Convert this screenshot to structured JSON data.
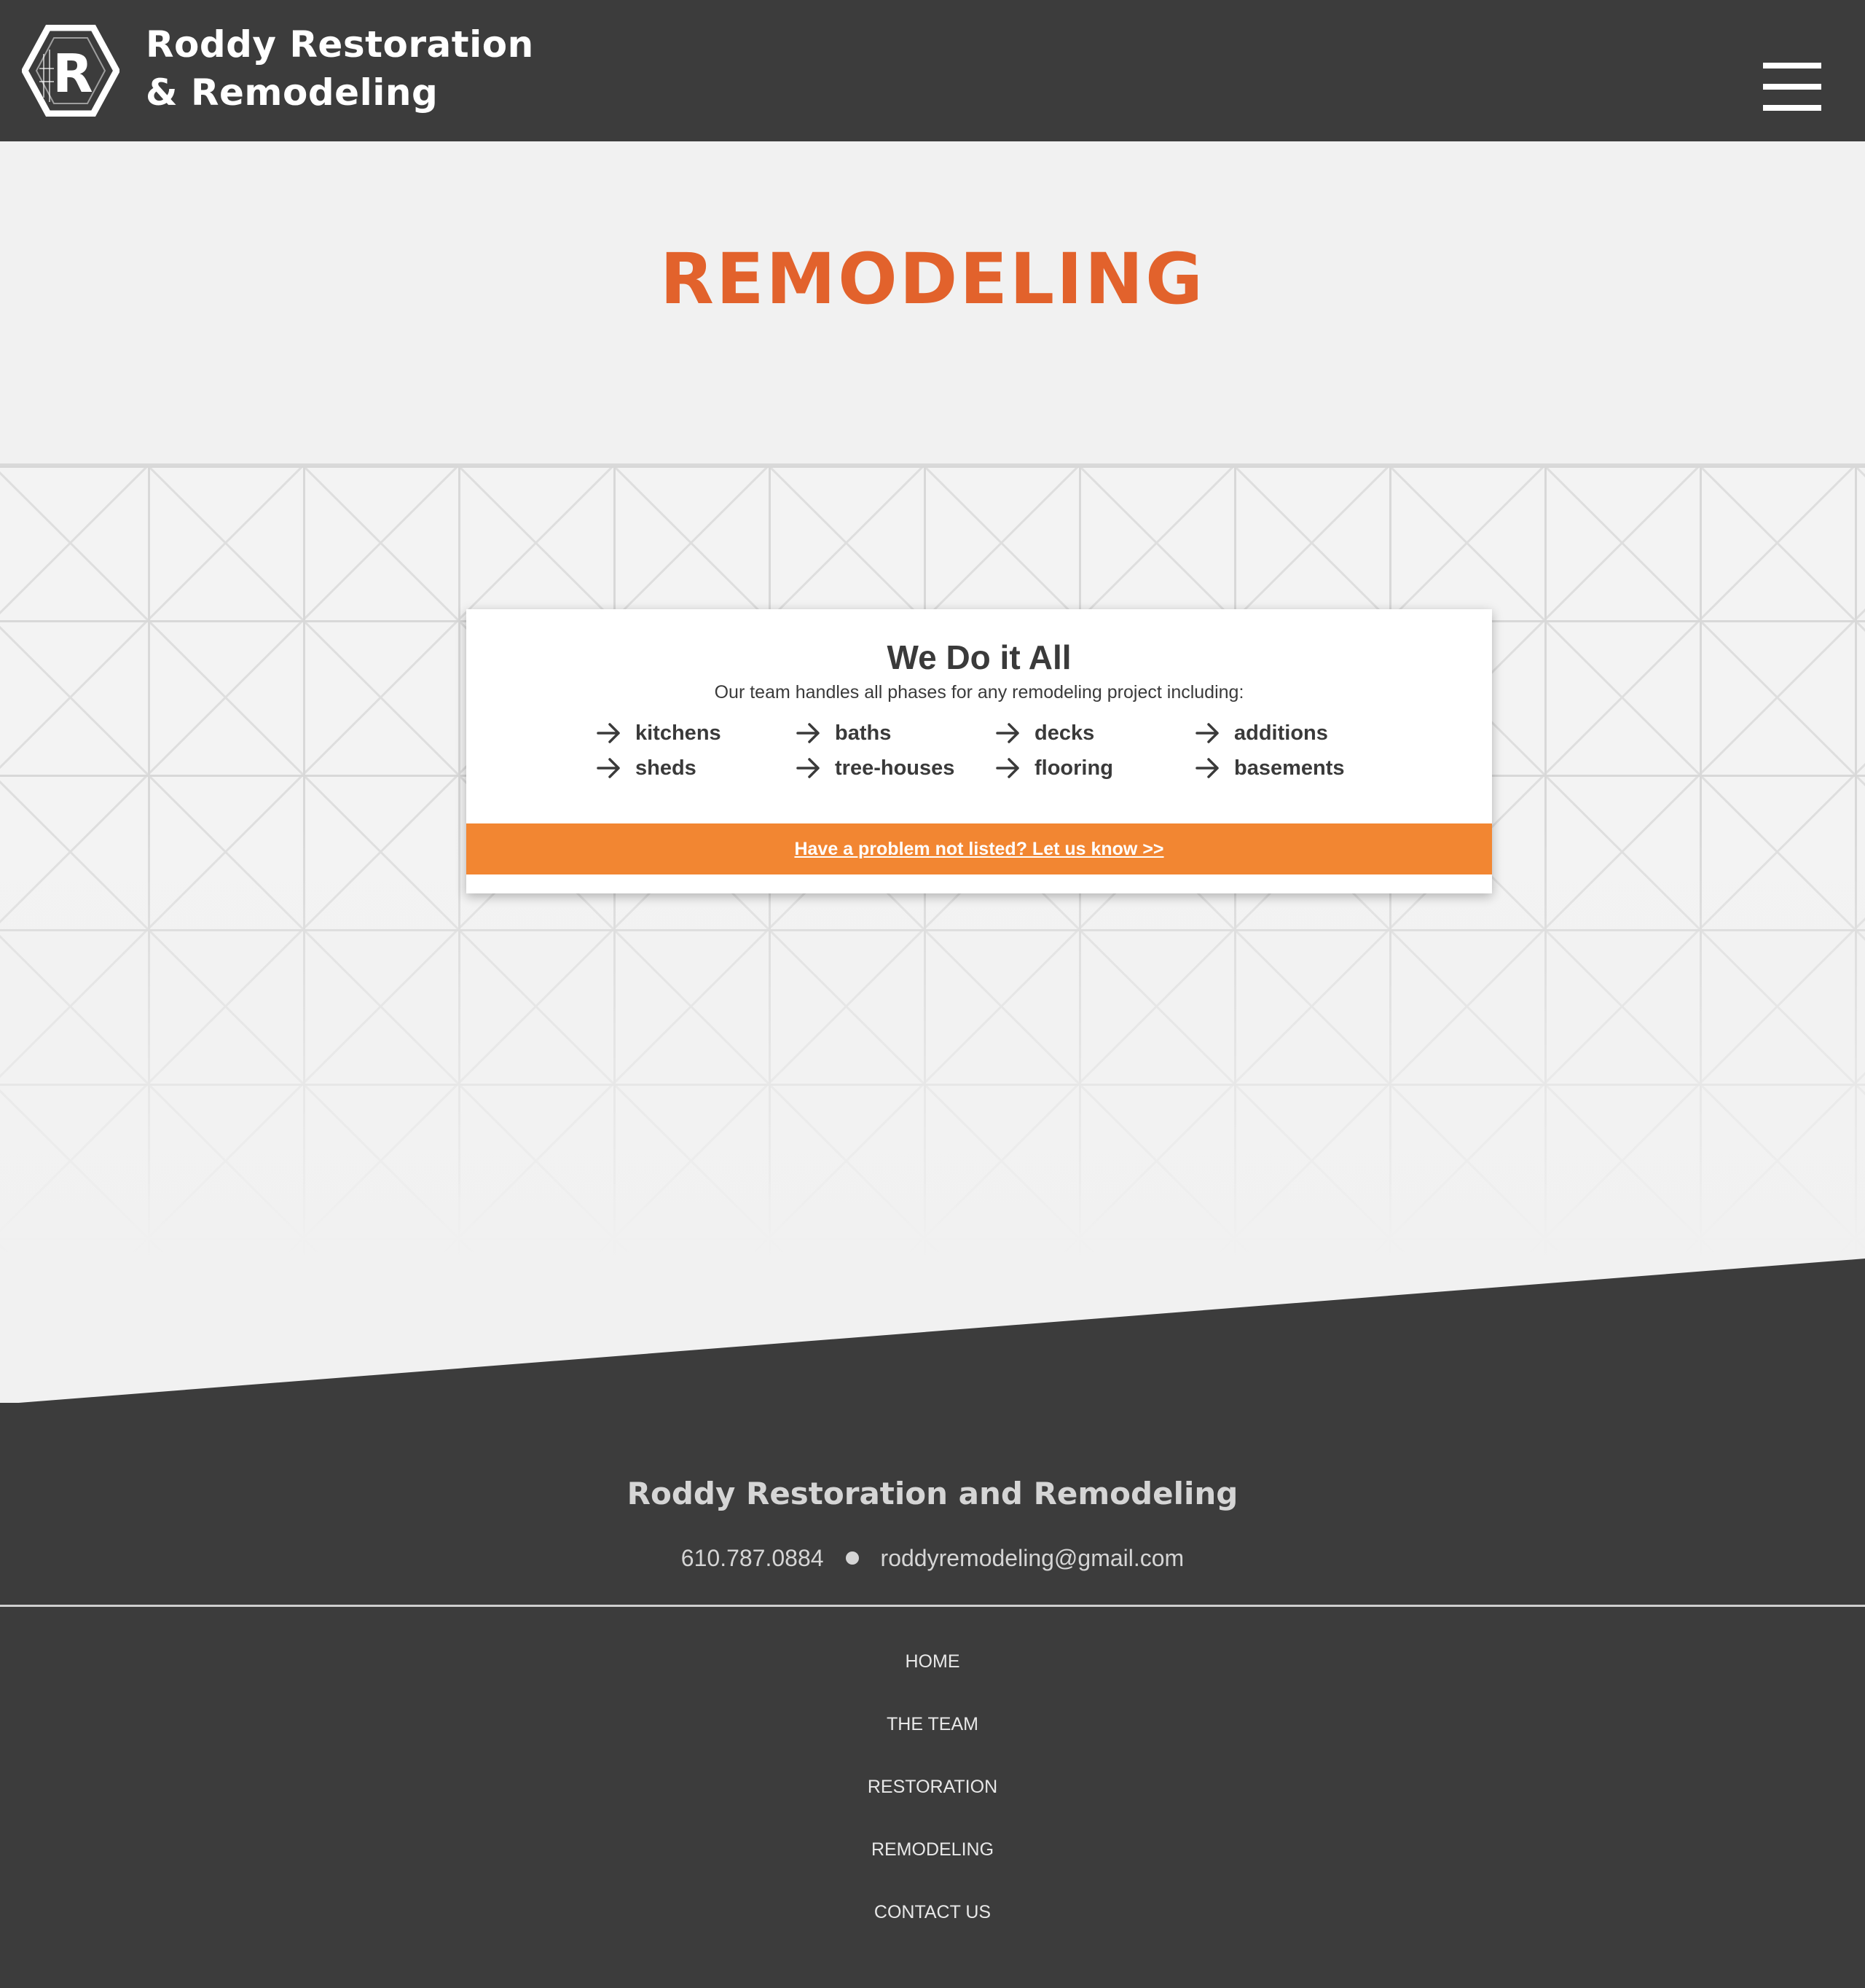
{
  "header": {
    "brand_line1": "Roddy Restoration",
    "brand_line2": "& Remodeling",
    "logo_icon": "hexagon-r-logo",
    "menu_icon": "hamburger-menu-icon"
  },
  "hero": {
    "title": "REMODELING"
  },
  "card": {
    "title": "We Do it All",
    "subtitle": "Our team handles all phases for any remodeling project including:",
    "services": [
      "kitchens",
      "baths",
      "decks",
      "additions",
      "sheds",
      "tree-houses",
      "flooring",
      "basements"
    ],
    "bullet_icon": "arrow-right-icon",
    "cta_label": "Have a problem not listed? Let us know >>"
  },
  "footer": {
    "company": "Roddy Restoration and Remodeling",
    "phone": "610.787.0884",
    "email": "roddyremodeling@gmail.com",
    "nav": [
      "HOME",
      "THE TEAM",
      "RESTORATION",
      "REMODELING",
      "CONTACT US"
    ]
  },
  "colors": {
    "header_bg": "#3c3c3c",
    "page_bg": "#f1f1f1",
    "title_orange": "#e2622c",
    "cta_orange": "#f28632",
    "text_dark": "#3a3a3a"
  }
}
